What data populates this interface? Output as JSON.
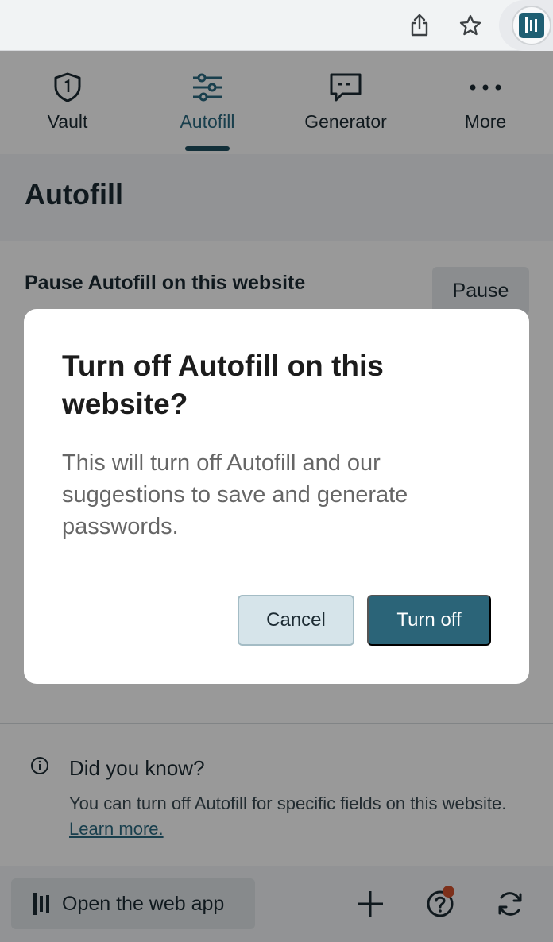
{
  "nav": {
    "items": [
      {
        "label": "Vault",
        "icon": "shield-icon",
        "active": false
      },
      {
        "label": "Autofill",
        "icon": "sliders-icon",
        "active": true
      },
      {
        "label": "Generator",
        "icon": "password-generator-icon",
        "active": false
      },
      {
        "label": "More",
        "icon": "more-dots-icon",
        "active": false
      }
    ]
  },
  "page": {
    "title": "Autofill",
    "pause_title": "Pause Autofill on this website",
    "pause_button": "Pause"
  },
  "tip": {
    "title": "Did you know?",
    "body": "You can turn off Autofill for specific fields on this website.",
    "link": "Learn more."
  },
  "footer": {
    "open_web_app": "Open the web app"
  },
  "dialog": {
    "title": "Turn off Autofill on this website?",
    "body": "This will turn off Autofill and our suggestions to save and generate passwords.",
    "cancel": "Cancel",
    "confirm": "Turn off"
  },
  "colors": {
    "accent": "#2b6478",
    "notification": "#d1502e"
  }
}
